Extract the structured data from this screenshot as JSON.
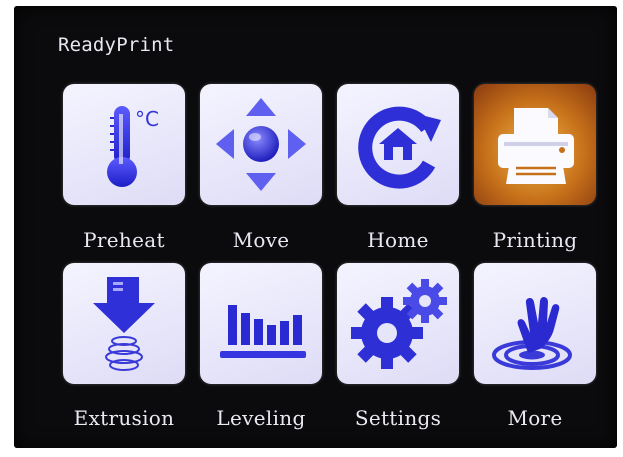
{
  "screen": {
    "title": "ReadyPrint"
  },
  "menu": [
    {
      "label": "Preheat",
      "icon": "thermometer-icon",
      "unit_text": "°C"
    },
    {
      "label": "Move",
      "icon": "move-arrows-icon"
    },
    {
      "label": "Home",
      "icon": "home-icon"
    },
    {
      "label": "Printing",
      "icon": "printer-icon",
      "active": true
    },
    {
      "label": "Extrusion",
      "icon": "extruder-icon"
    },
    {
      "label": "Leveling",
      "icon": "leveling-bars-icon"
    },
    {
      "label": "Settings",
      "icon": "gears-icon"
    },
    {
      "label": "More",
      "icon": "hand-pointer-icon"
    }
  ],
  "colors": {
    "screen_bg": "#0b0b0d",
    "tile_bg": "#e6e6fb",
    "icon_blue": "#2b2bdc",
    "active_tile": "#d07a20",
    "label_text": "#e9e9f2"
  }
}
